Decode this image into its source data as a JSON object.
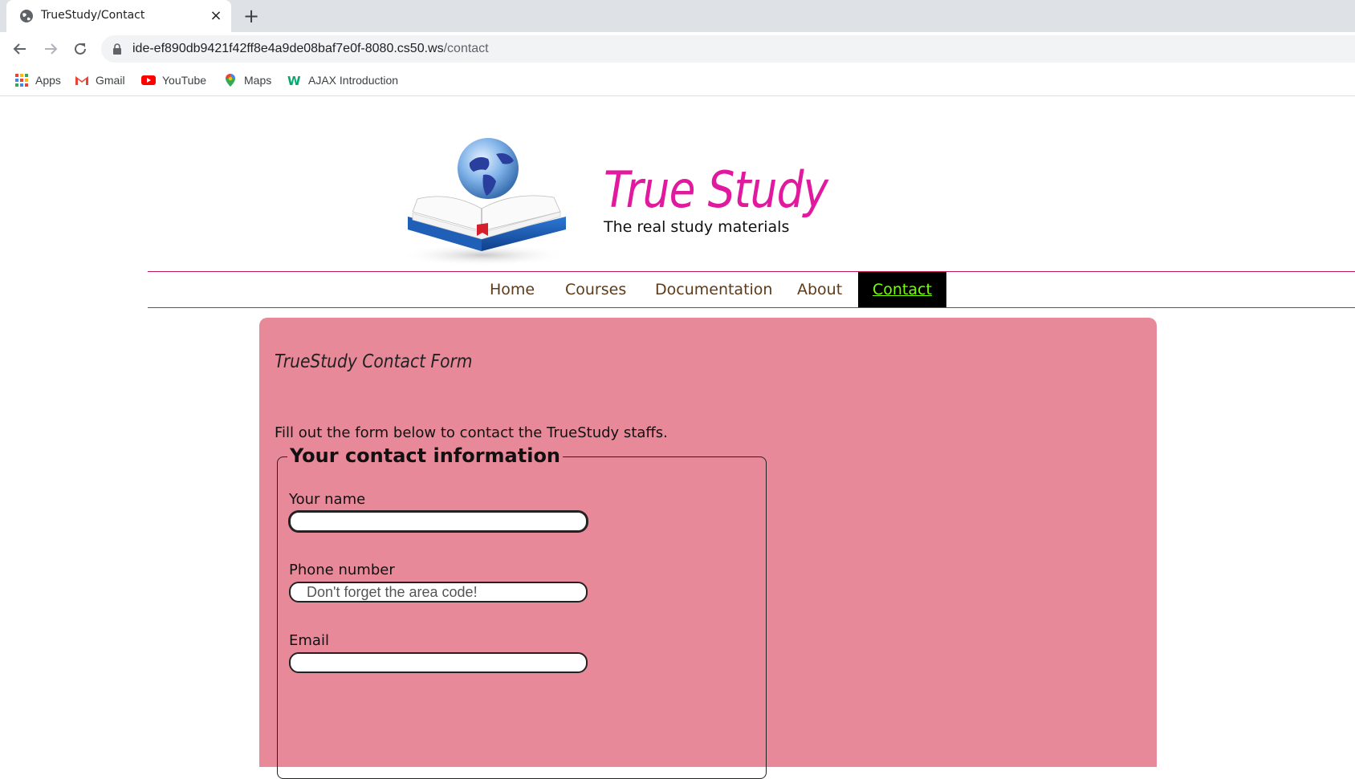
{
  "browser": {
    "tab_title": "TrueStudy/Contact",
    "url_host": "ide-ef890db9421f42ff8e4a9de08baf7e0f-8080.cs50.ws",
    "url_path": "/contact",
    "bookmarks": [
      {
        "label": "Apps",
        "icon": "apps-grid-icon"
      },
      {
        "label": "Gmail",
        "icon": "gmail-icon"
      },
      {
        "label": "YouTube",
        "icon": "youtube-icon"
      },
      {
        "label": "Maps",
        "icon": "maps-pin-icon"
      },
      {
        "label": "AJAX Introduction",
        "icon": "w3schools-icon"
      }
    ]
  },
  "site": {
    "title": "True Study",
    "tagline": "The real study materials",
    "title_color": "#e0199f"
  },
  "nav": {
    "items": [
      "Home",
      "Courses",
      "Documentation",
      "About",
      "Contact"
    ],
    "active": "Contact"
  },
  "contact": {
    "heading": "TrueStudy Contact Form",
    "intro": "Fill out the form below to contact the TrueStudy staffs.",
    "legend": "Your contact information",
    "fields": [
      {
        "label": "Your name",
        "value": "",
        "placeholder": ""
      },
      {
        "label": "Phone number",
        "value": "",
        "placeholder": "Don't forget the area code!"
      },
      {
        "label": "Email",
        "value": "",
        "placeholder": ""
      }
    ],
    "background_color": "#e8899a"
  }
}
